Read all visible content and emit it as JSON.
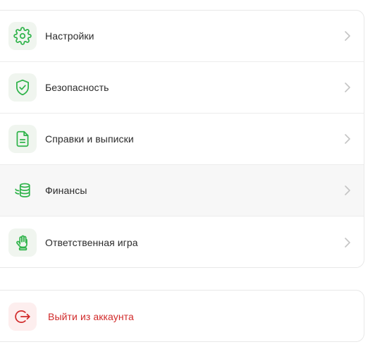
{
  "menu": {
    "items": [
      {
        "label": "Настройки",
        "icon": "gear-icon"
      },
      {
        "label": "Безопасность",
        "icon": "shield-check-icon"
      },
      {
        "label": "Справки и выписки",
        "icon": "document-icon"
      },
      {
        "label": "Финансы",
        "icon": "coins-icon"
      },
      {
        "label": "Ответственная игра",
        "icon": "hand-icon"
      }
    ]
  },
  "logout": {
    "label": "Выйти из аккаунта",
    "icon": "logout-icon"
  },
  "colors": {
    "accent_green": "#2fb34a",
    "danger_red": "#d12a2a",
    "icon_bg_green": "#f0f5ef",
    "icon_bg_red": "#fdeeee",
    "chevron": "#c4c4c4"
  }
}
